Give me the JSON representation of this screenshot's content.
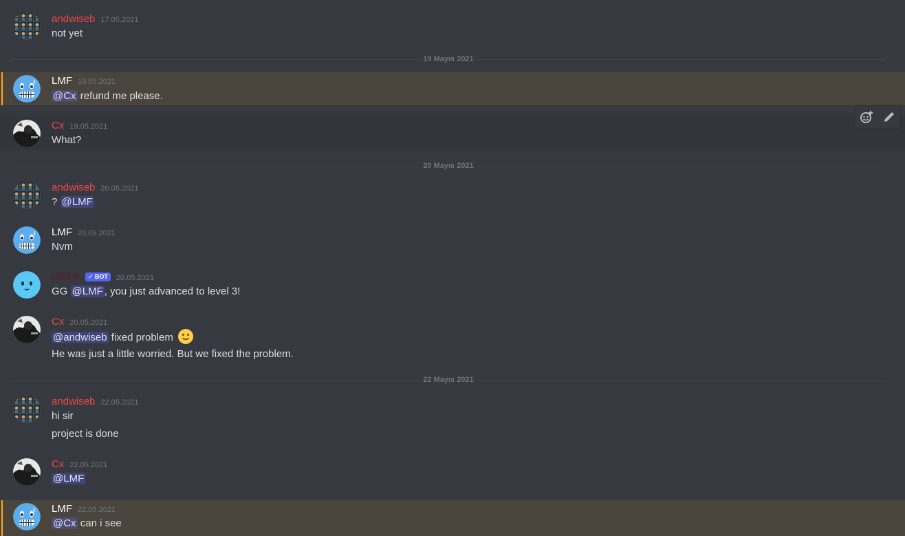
{
  "colors": {
    "andwiseb": "#f04747",
    "lmf": "#ffffff",
    "cx": "#f04747",
    "mee6": "#5b1e2b",
    "mention_bg": "#5865f2",
    "mention_highlight": "#faa81a"
  },
  "dividers": [
    {
      "label": "19 Mayıs 2021"
    },
    {
      "label": "20 Mayıs 2021"
    },
    {
      "label": "22 Mayıs 2021"
    }
  ],
  "messages": [
    {
      "author": "andwiseb",
      "timestamp": "17.05.2021",
      "avatar": "grid-avatar-icon",
      "lines": [
        {
          "text": "not yet"
        }
      ]
    },
    {
      "author": "LMF",
      "timestamp": "19.05.2021",
      "avatar": "cold-face-emoji-icon",
      "mention": "@Cx",
      "text": "refund me please."
    },
    {
      "author": "Cx",
      "timestamp": "19.05.2021",
      "avatar": "bw-photo-avatar-icon",
      "lines": [
        {
          "text": "What?"
        }
      ]
    },
    {
      "author": "andwiseb",
      "timestamp": "20.05.2021",
      "avatar": "grid-avatar-icon",
      "prefix": "?",
      "mention": "@LMF"
    },
    {
      "author": "LMF",
      "timestamp": "20.05.2021",
      "avatar": "cold-face-emoji-icon",
      "lines": [
        {
          "text": "Nvm"
        }
      ]
    },
    {
      "author": "MEE6",
      "bot_tag": "✓ BOT",
      "timestamp": "20.05.2021",
      "avatar": "mee6-face-icon",
      "prefix": "GG",
      "mention": "@LMF",
      "text": ", you just advanced to level 3!"
    },
    {
      "author": "Cx",
      "timestamp": "20.05.2021",
      "avatar": "bw-photo-avatar-icon",
      "mention": "@andwiseb",
      "text": "fixed problem",
      "line2": "He was just a little worried. But we fixed the problem."
    },
    {
      "author": "andwiseb",
      "timestamp": "22.05.2021",
      "avatar": "grid-avatar-icon",
      "line1": "hi sir",
      "line2": "project is done"
    },
    {
      "author": "Cx",
      "timestamp": "22.05.2021",
      "avatar": "bw-photo-avatar-icon",
      "mention": "@LMF"
    },
    {
      "author": "LMF",
      "timestamp": "22.05.2021",
      "avatar": "cold-face-emoji-icon",
      "mention": "@Cx",
      "text": "can i see"
    }
  ],
  "toolbar": {
    "icons": [
      "add-reaction-icon",
      "edit-pencil-icon"
    ]
  }
}
